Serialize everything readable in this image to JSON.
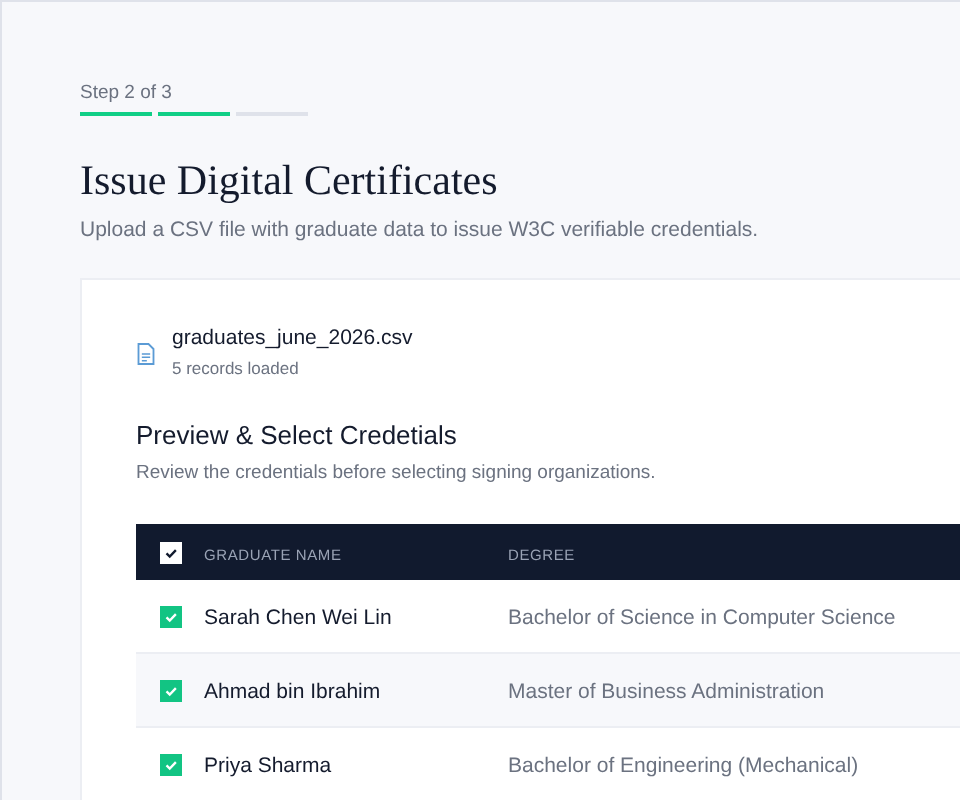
{
  "stepper": {
    "label": "Step 2 of 3",
    "steps": [
      {
        "done": true
      },
      {
        "done": true
      },
      {
        "done": false
      }
    ]
  },
  "title": "Issue Digital Certificates",
  "subtitle": "Upload a CSV file with graduate data to issue W3C verifiable credentials.",
  "file": {
    "name": "graduates_june_2026.csv",
    "meta": "5 records loaded"
  },
  "section": {
    "title": "Preview & Select Credetials",
    "description": "Review the credentials before selecting signing organizations."
  },
  "table": {
    "select_all": {
      "checked": true
    },
    "columns": [
      "GRADUATE NAME",
      "DEGREE"
    ],
    "rows": [
      {
        "checked": true,
        "name": "Sarah Chen Wei Lin",
        "degree": "Bachelor of Science in Computer Science"
      },
      {
        "checked": true,
        "name": "Ahmad bin Ibrahim",
        "degree": "Master of Business Administration"
      },
      {
        "checked": true,
        "name": "Priya Sharma",
        "degree": "Bachelor of Engineering (Mechanical)"
      }
    ]
  }
}
